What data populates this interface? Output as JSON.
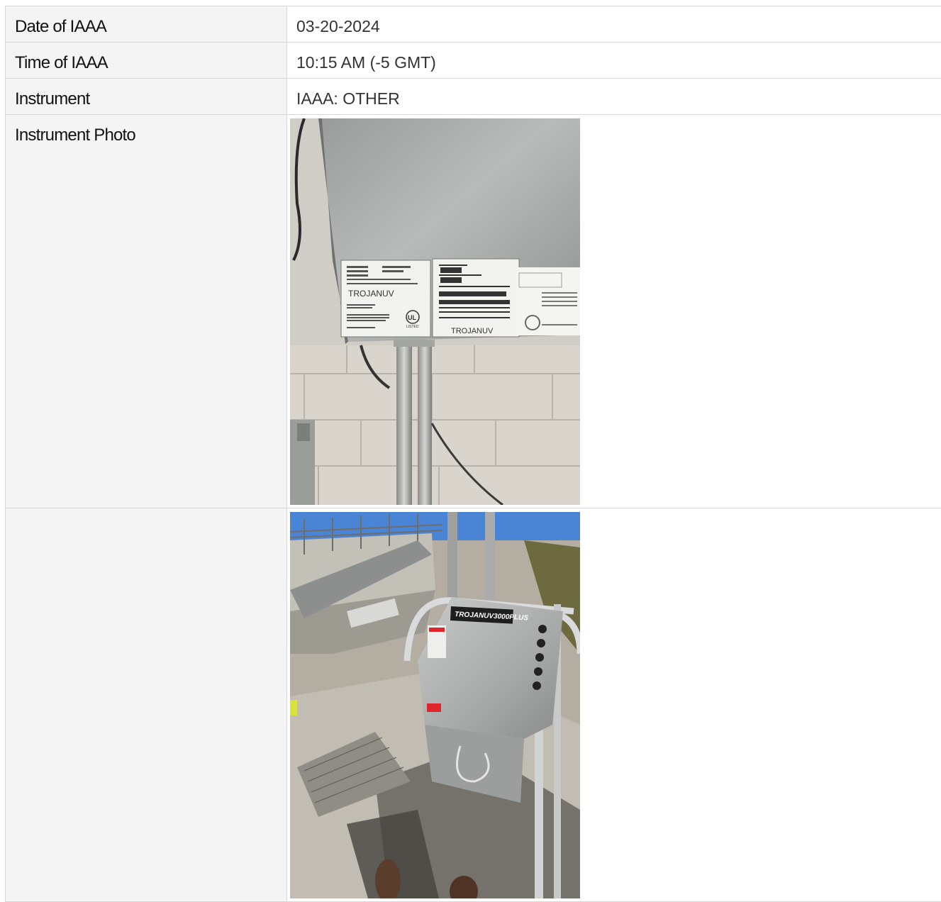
{
  "rows": [
    {
      "label": "Date of IAAA",
      "value": "03-20-2024"
    },
    {
      "label": "Time of IAAA",
      "value": "10:15 AM (-5 GMT)"
    },
    {
      "label": "Instrument",
      "value": "IAAA: OTHER"
    },
    {
      "label": "Instrument Photo",
      "value": ""
    },
    {
      "label": "",
      "value": ""
    }
  ],
  "photos": {
    "nameplate": {
      "label_left_brand": "TROJANUV",
      "label_right_brand": "TROJANUV",
      "ul_mark": "UL",
      "ul_listed": "LISTED"
    },
    "unit": {
      "cabinet_brand": "TROJANUV3000PLUS"
    }
  },
  "colors": {
    "label_bg": "#f4f4f4",
    "border": "#d9d9d9",
    "trojan_red": "#e0262c"
  }
}
